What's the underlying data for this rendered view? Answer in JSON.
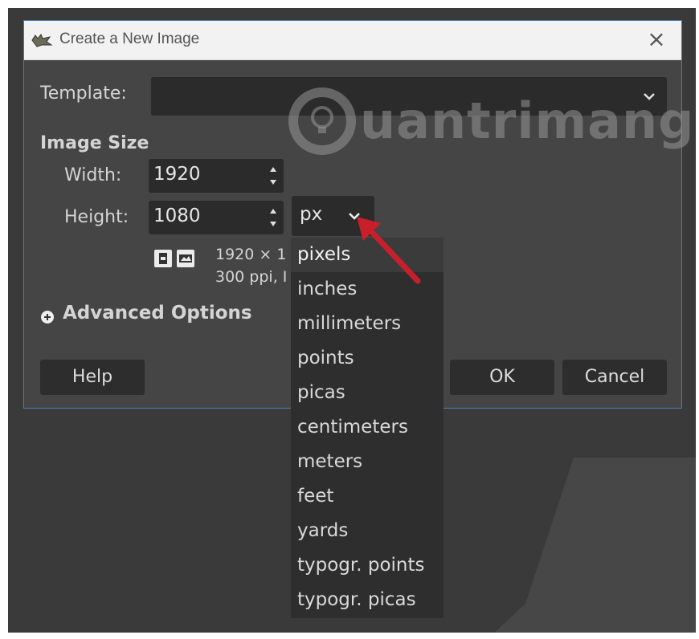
{
  "window": {
    "title": "Create a New Image",
    "close_icon": "close-icon"
  },
  "template": {
    "label": "Template:",
    "value": ""
  },
  "image_size": {
    "heading": "Image Size",
    "width_label": "Width:",
    "width_value": "1920",
    "height_label": "Height:",
    "height_value": "1080",
    "unit_value": "px",
    "info_line1": "1920 × 1",
    "info_line2": "300 ppi, I"
  },
  "advanced": {
    "label": "Advanced Options"
  },
  "buttons": {
    "help": "Help",
    "ok": "OK",
    "cancel": "Cancel"
  },
  "unit_menu": {
    "items": [
      "pixels",
      "inches",
      "millimeters",
      "points",
      "picas",
      "centimeters",
      "meters",
      "feet",
      "yards",
      "typogr. points",
      "typogr. picas"
    ],
    "selected_index": 0
  },
  "watermark": {
    "text": "uantrimang"
  },
  "colors": {
    "dialog_bg": "#454545",
    "field_bg": "#2b2b2b",
    "dialog_border": "#4a7bb5",
    "arrow": "#c8202a"
  }
}
